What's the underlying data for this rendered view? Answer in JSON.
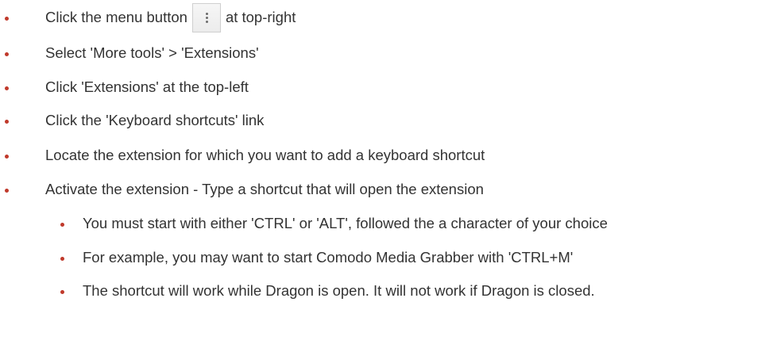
{
  "steps": [
    {
      "before": "Click the menu button",
      "icon": "kebab-menu-icon",
      "after": "at top-right"
    },
    {
      "text": "Select 'More tools' > 'Extensions'"
    },
    {
      "text": "Click 'Extensions' at the top-left"
    },
    {
      "text": "Click the 'Keyboard shortcuts' link"
    },
    {
      "text": "Locate the extension for which you want to add a keyboard shortcut"
    },
    {
      "text": "Activate the extension - Type a shortcut that will open the extension"
    }
  ],
  "substeps": [
    {
      "text": "You must start with either 'CTRL' or 'ALT', followed the a character of your choice"
    },
    {
      "text": "For example, you may want to start Comodo Media Grabber with 'CTRL+M'"
    },
    {
      "text": "The shortcut will work while Dragon is open. It will not work if Dragon is closed."
    }
  ],
  "colors": {
    "bullet": "#c0392b",
    "text": "#333333"
  }
}
